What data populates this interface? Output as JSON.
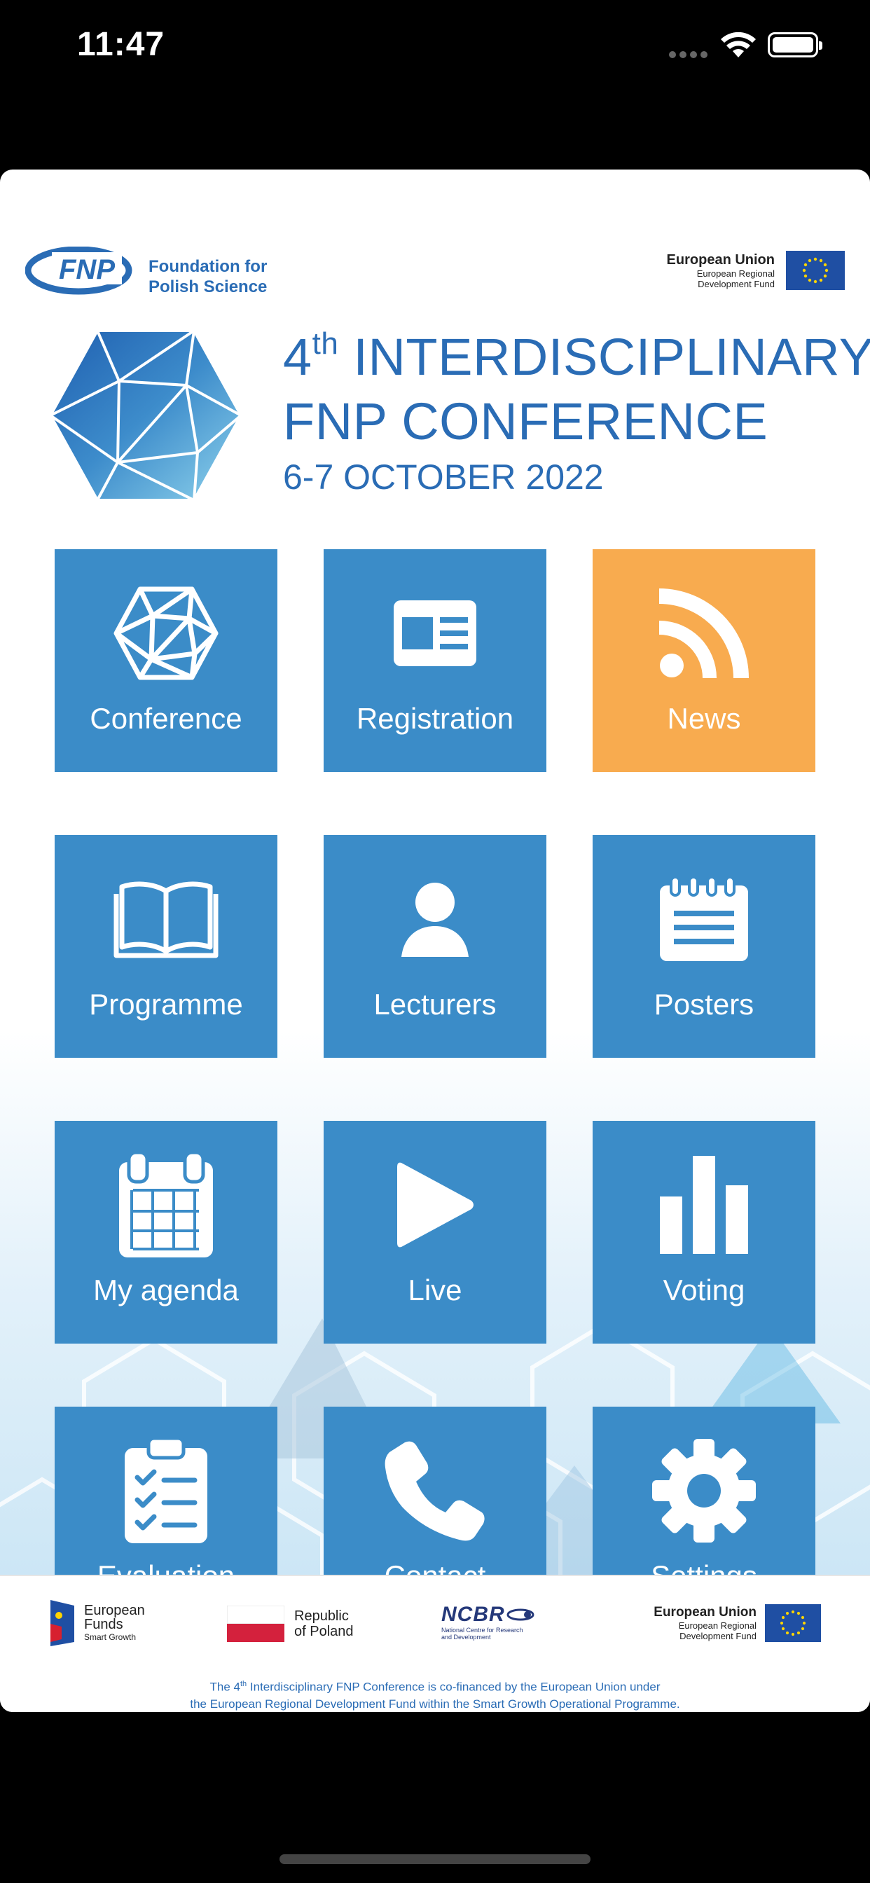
{
  "status_bar": {
    "time": "11:47"
  },
  "header": {
    "fnp_line1": "Foundation for",
    "fnp_line2": "Polish Science",
    "fnp_mark": "FNP",
    "eu_title": "European Union",
    "eu_sub1": "European Regional",
    "eu_sub2": "Development Fund"
  },
  "conference": {
    "ordinal_num": "4",
    "ordinal_suffix": "th",
    "title_line1_rest": " INTERDISCIPLINARY",
    "title_line2": "FNP CONFERENCE",
    "date": "6-7 OCTOBER 2022"
  },
  "tiles": [
    {
      "label": "Conference",
      "icon": "polyhedron-icon"
    },
    {
      "label": "Registration",
      "icon": "id-card-icon"
    },
    {
      "label": "News",
      "icon": "rss-icon"
    },
    {
      "label": "Programme",
      "icon": "open-book-icon"
    },
    {
      "label": "Lecturers",
      "icon": "person-icon"
    },
    {
      "label": "Posters",
      "icon": "notepad-icon"
    },
    {
      "label": "My agenda",
      "icon": "calendar-icon"
    },
    {
      "label": "Live",
      "icon": "play-icon"
    },
    {
      "label": "Voting",
      "icon": "bar-chart-icon"
    },
    {
      "label": "Evaluation",
      "icon": "clipboard-check-icon"
    },
    {
      "label": "Contact",
      "icon": "phone-icon"
    },
    {
      "label": "Settings",
      "icon": "gear-icon"
    }
  ],
  "footer": {
    "ef_line1": "European",
    "ef_line2": "Funds",
    "ef_line3": "Smart Growth",
    "rp_line1": "Republic",
    "rp_line2": "of Poland",
    "ncbr_mark": "NCBR",
    "ncbr_sub1": "National Centre for Research",
    "ncbr_sub2": "and Development",
    "eu_title": "European Union",
    "eu_sub1": "European Regional",
    "eu_sub2": "Development Fund",
    "caption_pre": "The 4",
    "caption_sup": "th",
    "caption_line1_rest": " Interdisciplinary FNP Conference is co-financed by the European Union under",
    "caption_line2": "the European Regional Development Fund within the Smart Growth Operational Programme."
  },
  "colors": {
    "tile_blue": "#3b8cc8",
    "tile_orange": "#f8ab4f",
    "brand_blue": "#2a6cb5"
  }
}
